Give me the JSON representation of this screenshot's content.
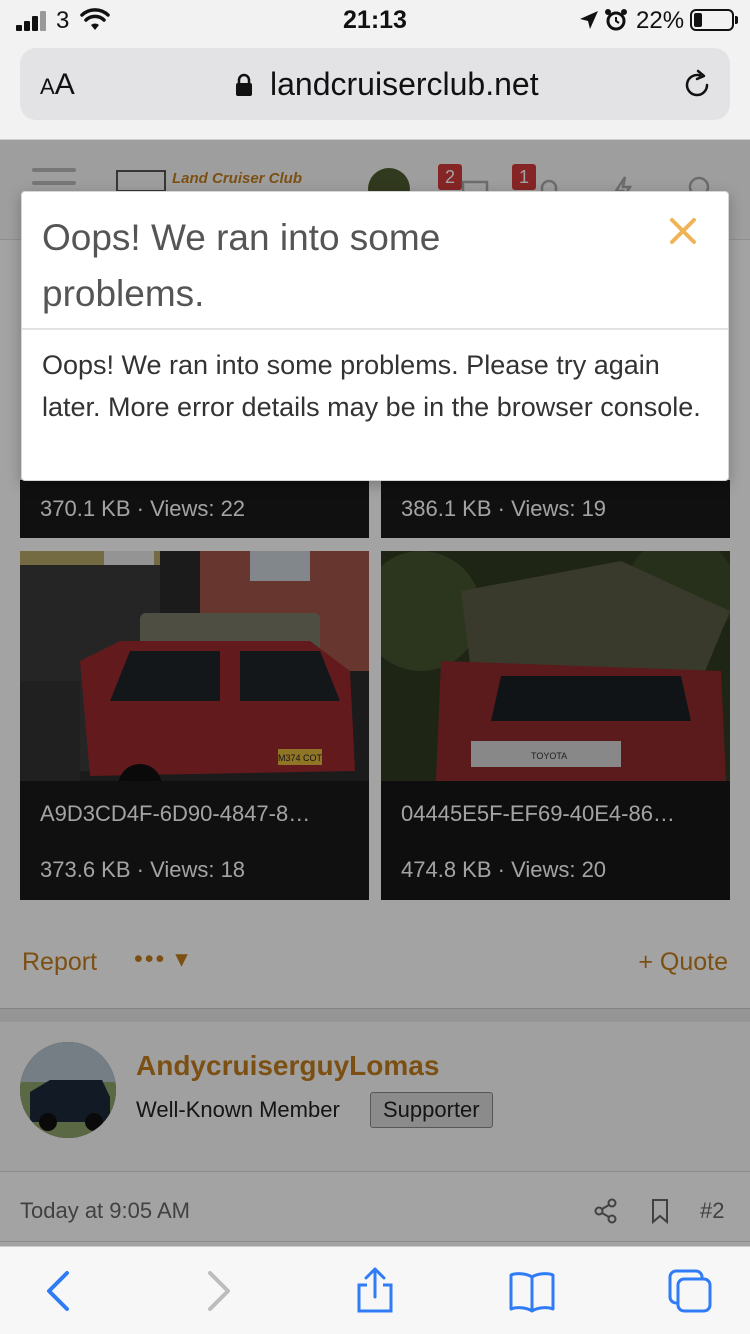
{
  "status_bar": {
    "carrier": "3",
    "time": "21:13",
    "battery_percent": "22%",
    "battery_level": 0.22
  },
  "browser": {
    "text_size_label": "AA",
    "url": "landcruiserclub.net"
  },
  "site_header": {
    "logo_text": "Land Cruiser Club",
    "messages_badge": "2",
    "alerts_badge": "1"
  },
  "modal": {
    "title": "Oops! We ran into some problems.",
    "body": "Oops! We ran into some problems. Please try again later. More error details may be in the browser console.",
    "accent_color": "#f0b357"
  },
  "attachments": [
    {
      "name": "",
      "meta": "370.1 KB · Views: 22"
    },
    {
      "name": "",
      "meta": "386.1 KB · Views: 19"
    },
    {
      "name": "A9D3CD4F-6D90-4847-8…",
      "meta": "373.6 KB · Views: 18",
      "plate": "M374 COT"
    },
    {
      "name": "04445E5F-EF69-40E4-86…",
      "meta": "474.8 KB · Views: 20",
      "grille": "TOYOTA"
    }
  ],
  "post_actions": {
    "report": "Report",
    "more": "•••",
    "quote": "+ Quote"
  },
  "post": {
    "username": "AndycruiserguyLomas",
    "user_title": "Well-Known Member",
    "badge": "Supporter",
    "date": "Today at 9:05 AM",
    "number": "#2"
  },
  "colors": {
    "brand": "#c37d1e",
    "badge_red": "#d13b3b",
    "ios_blue": "#2f7cf6"
  }
}
